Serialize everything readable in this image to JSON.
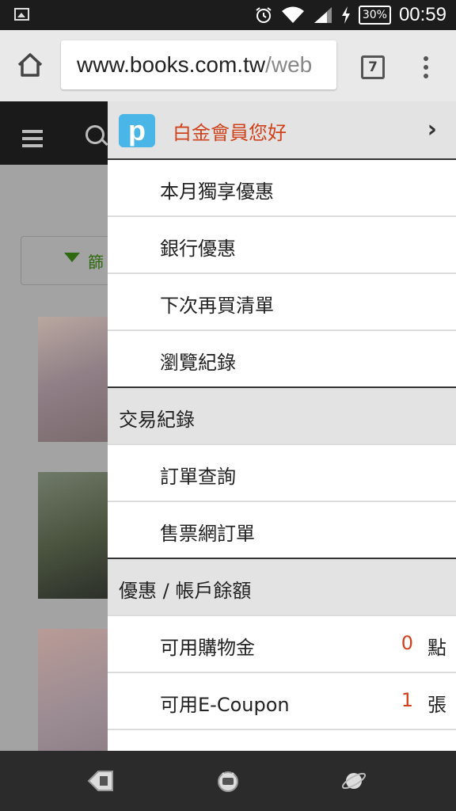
{
  "status": {
    "battery": "30%",
    "time": "00:59"
  },
  "browser": {
    "url_host": "www.books.com.tw",
    "url_path": "/web",
    "tab_count": "7"
  },
  "page": {
    "filter_label": "篩"
  },
  "drawer": {
    "greeting": "白金會員您好",
    "chevron": "›",
    "items_top": [
      {
        "label": "本月獨享優惠"
      },
      {
        "label": "銀行優惠"
      },
      {
        "label": "下次再買清單"
      },
      {
        "label": "瀏覽紀錄"
      }
    ],
    "section_trade": "交易紀錄",
    "items_trade": [
      {
        "label": "訂單查詢"
      },
      {
        "label": "售票網訂單"
      }
    ],
    "section_balance": "優惠 / 帳戶餘額",
    "items_balance": [
      {
        "label": "可用購物金",
        "count": "0",
        "unit": "點"
      },
      {
        "label": "可用E-Coupon",
        "count": "1",
        "unit": "張"
      }
    ]
  }
}
